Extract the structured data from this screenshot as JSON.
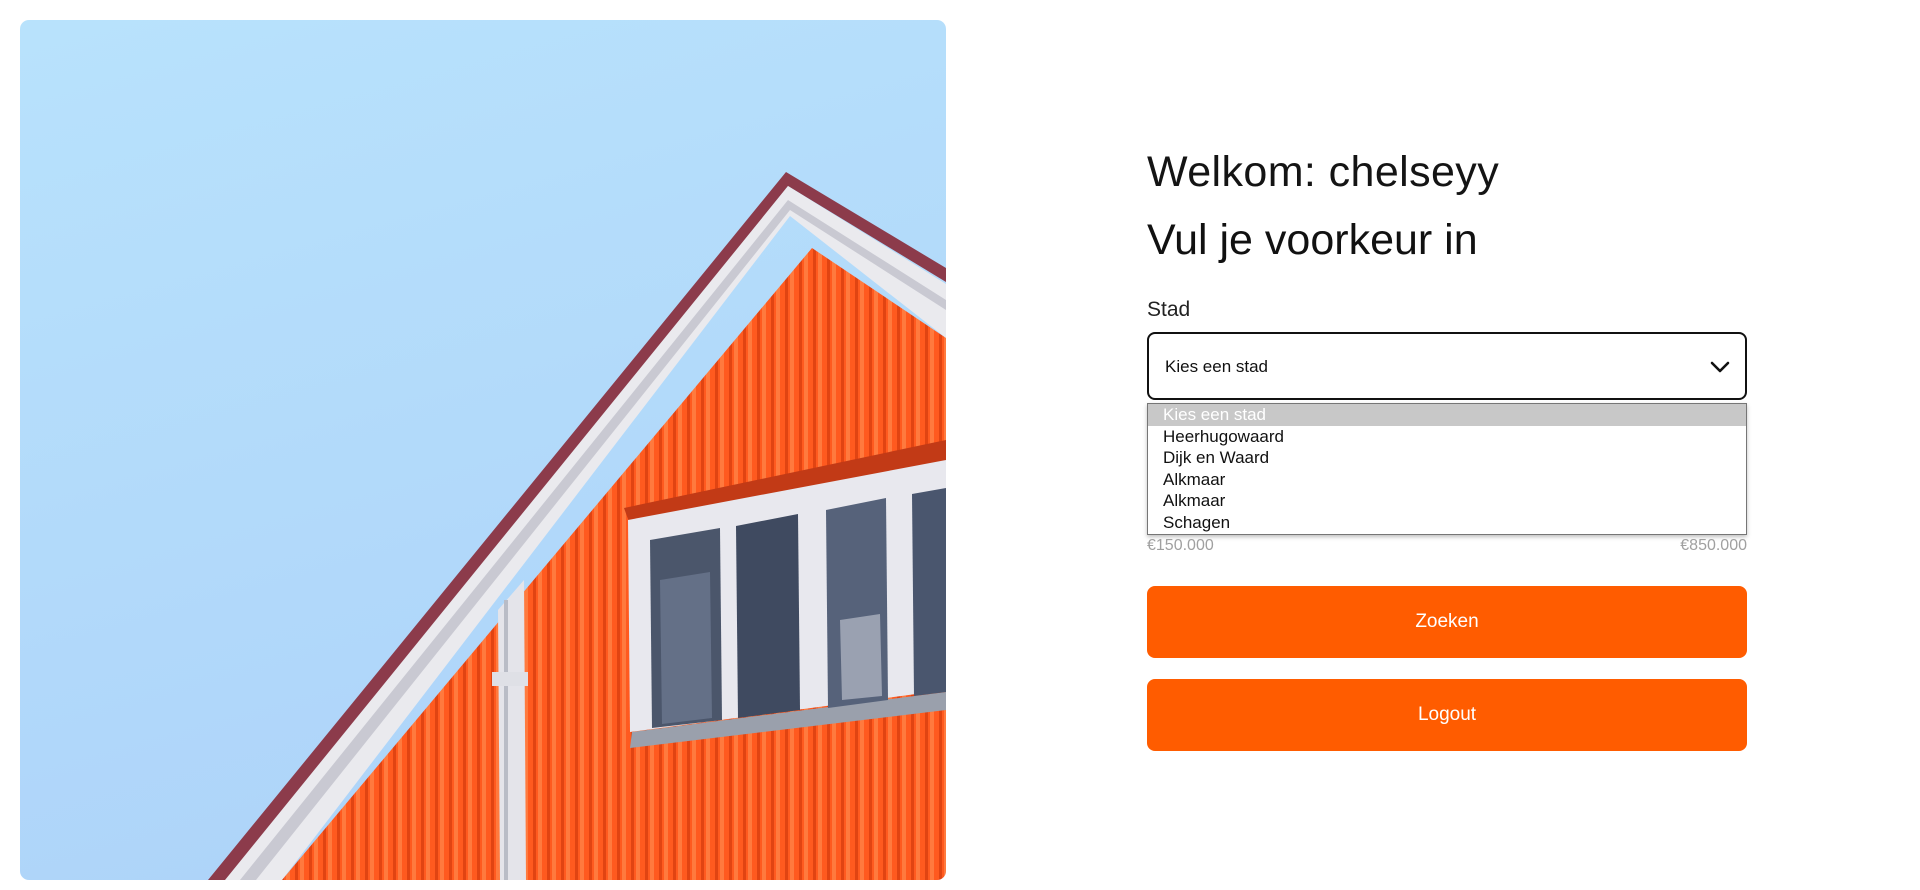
{
  "hero": {
    "icon": "house-facade-image",
    "colors": {
      "sky": "#b6e0fb",
      "siding": "#ff5a1f",
      "trim": "#e9e9ee",
      "roof_edge": "#8a3a4a"
    }
  },
  "form": {
    "greeting": "Welkom: chelseyy",
    "subtitle": "Vul je voorkeur in",
    "city_label": "Stad",
    "city_select": {
      "selected": "Kies een stad",
      "chevron_icon": "chevron-down-icon",
      "options": [
        "Kies een stad",
        "Heerhugowaard",
        "Dijk en Waard",
        "Alkmaar",
        "Alkmaar",
        "Schagen"
      ]
    },
    "price_range": {
      "min_label": "€150.000",
      "max_label": "€850.000"
    },
    "search_button": "Zoeken",
    "logout_button": "Logout",
    "accent_color": "#ff5c00"
  }
}
